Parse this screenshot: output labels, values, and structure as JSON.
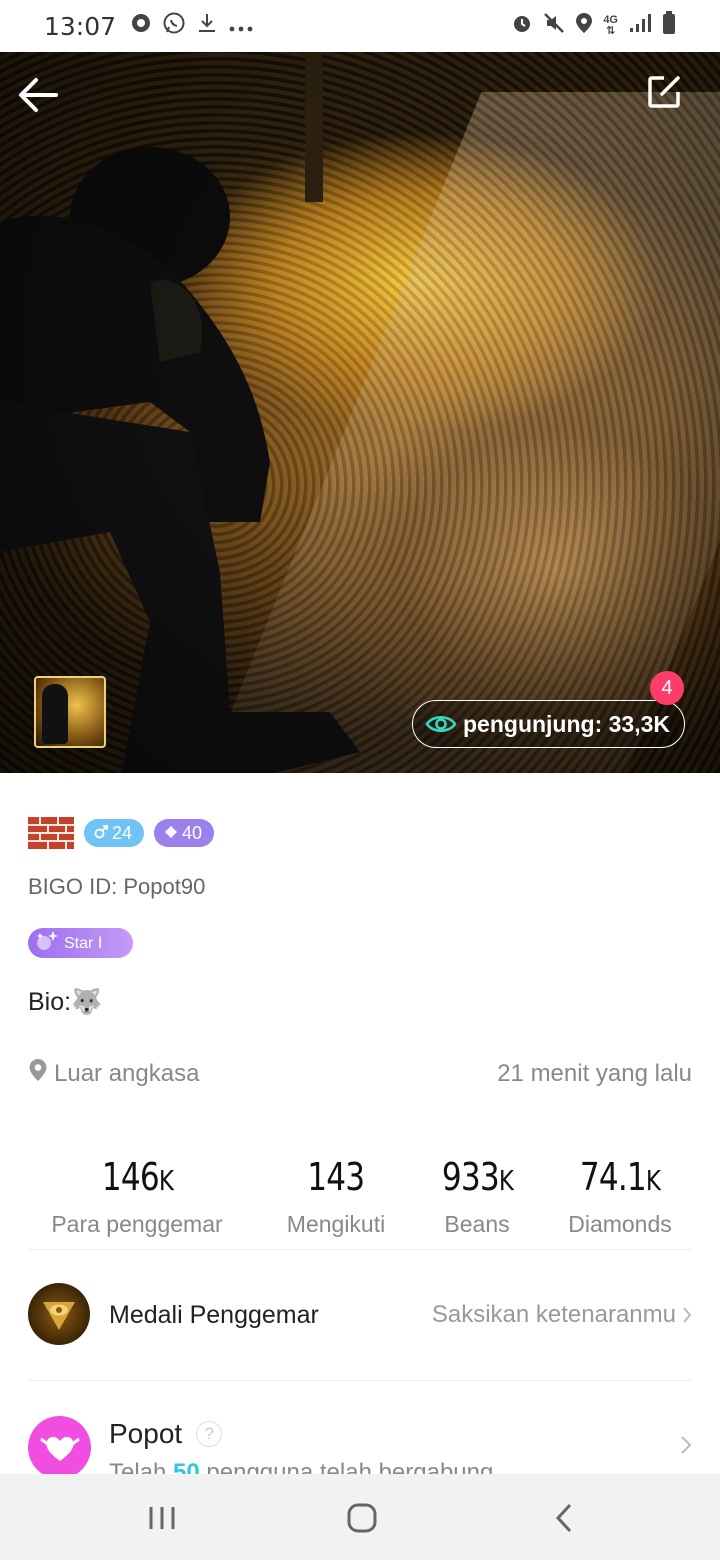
{
  "status_bar": {
    "time": "13:07",
    "left_icons": [
      "record-icon",
      "whatsapp-icon",
      "download-icon",
      "more-dots-icon"
    ],
    "right_icons": [
      "alarm-icon",
      "mute-icon",
      "location-icon",
      "network-4g-icon",
      "signal-icon",
      "battery-icon"
    ],
    "network_label": "4G"
  },
  "hero": {
    "visitors_label": "pengunjung: 33,3K",
    "notification_count": "4"
  },
  "profile": {
    "gender_age": "24",
    "diamond_level": "40",
    "bigo_id": "BIGO ID: Popot90",
    "star_badge": "Star Ⅰ",
    "bio_label": "Bio:",
    "bio_emoji": "🐺",
    "location": "Luar angkasa",
    "last_seen": "21 menit yang lalu"
  },
  "stats": [
    {
      "value": "146",
      "unit": "K",
      "label": "Para penggemar"
    },
    {
      "value": "143",
      "unit": "",
      "label": "Mengikuti"
    },
    {
      "value": "933",
      "unit": "K",
      "label": "Beans"
    },
    {
      "value": "74.1",
      "unit": "K",
      "label": "Diamonds"
    }
  ],
  "fan_medal": {
    "title": "Medali Penggemar",
    "link": "Saksikan ketenaranmu"
  },
  "family": {
    "name": "Popot",
    "sub_prefix": "Telah ",
    "sub_count": "50",
    "sub_suffix": " pengguna telah bergabung"
  },
  "colors": {
    "accent_cyan": "#2ec7d8",
    "badge_red": "#ff3d6b",
    "gender_blue": "#6fc3f5",
    "diamond_purple": "#9c80ec",
    "family_pink": "#f14de0"
  }
}
